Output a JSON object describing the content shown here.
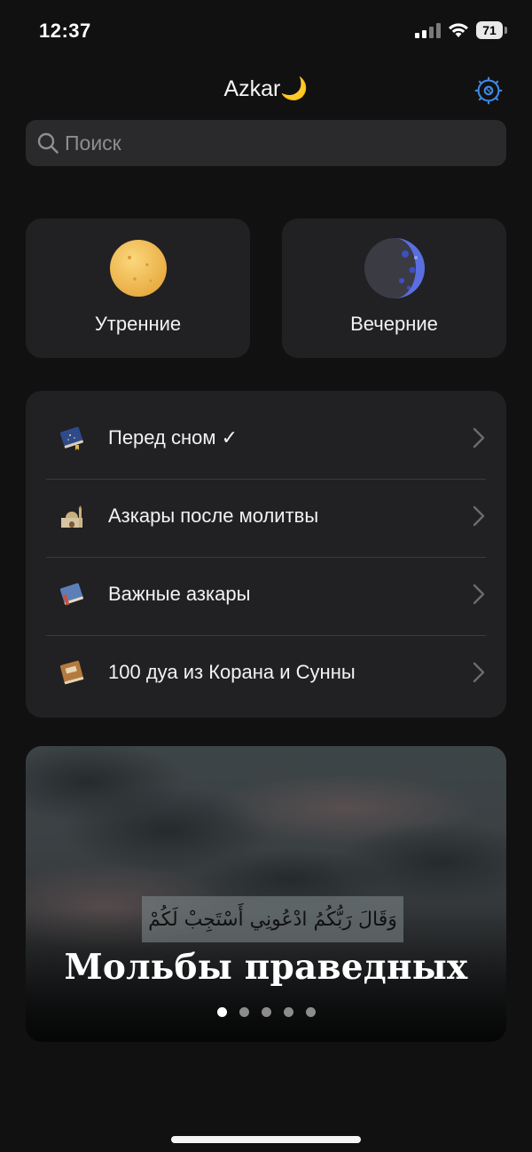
{
  "status_bar": {
    "time": "12:37",
    "battery": "71"
  },
  "header": {
    "title": "Azkar🌙"
  },
  "search": {
    "placeholder": "Поиск"
  },
  "cards": {
    "morning": {
      "label": "Утренние"
    },
    "evening": {
      "label": "Вечерние"
    }
  },
  "list": {
    "items": [
      {
        "label": "Перед сном ✓"
      },
      {
        "label": "Азкары после молитвы"
      },
      {
        "label": "Важные азкары"
      },
      {
        "label": "100 дуа из Корана и Сунны"
      }
    ]
  },
  "banner": {
    "arabic": "وَقَالَ رَبُّكُمُ ادْعُونِي أَسْتَجِبْ لَكُمْ",
    "title": "Мольбы праведных",
    "dots_count": 5,
    "active_dot": 0
  },
  "colors": {
    "accent": "#3f88e6",
    "background": "#111112",
    "card": "#212123"
  }
}
